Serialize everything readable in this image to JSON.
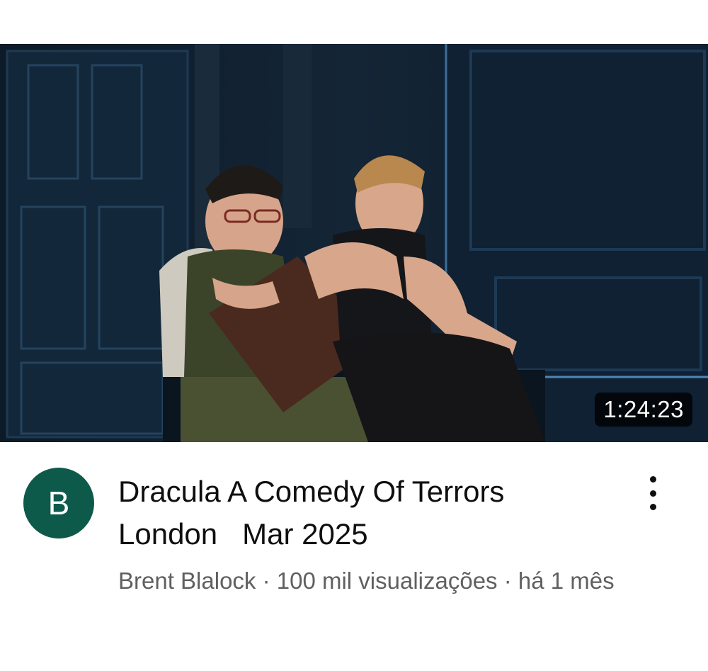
{
  "video": {
    "duration": "1:24:23",
    "thumbnail_icon": "stage-performance-thumbnail",
    "title": "Dracula A Comedy Of Terrors\nLondon   Mar 2025",
    "channel_initial": "B",
    "subtitle": "Brent Blalock · 100 mil visualizações · há 1 mês",
    "menu_icon": "more-vert-icon"
  },
  "colors": {
    "avatar_bg": "#0e5a4a",
    "title": "#0f0f0f",
    "subtitle": "#606060"
  }
}
